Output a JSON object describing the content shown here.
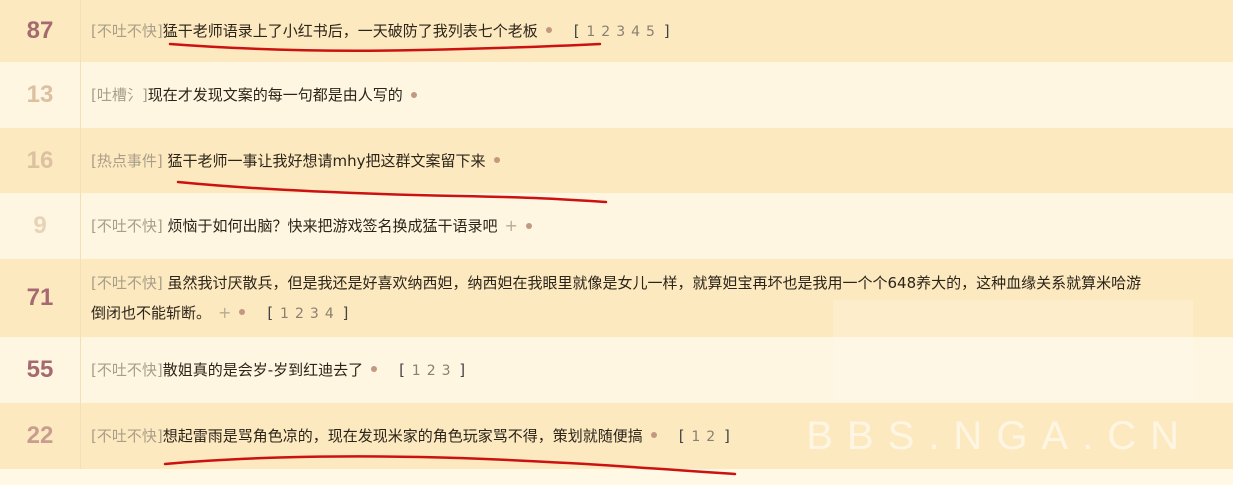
{
  "watermark": "BBS.NGA.CN",
  "colors": {
    "count_high": "#a0666c",
    "count_low": "#e1c7a8",
    "annotation": "#cc1111"
  },
  "rows": [
    {
      "count": "87",
      "category": "[不吐不快]",
      "title": "猛干老师语录上了小红书后，一天破防了我列表七个老板",
      "title_line2": "",
      "plus": false,
      "pages": [
        "1",
        "2",
        "3",
        "4",
        "5"
      ]
    },
    {
      "count": "13",
      "category": "[吐槽氵]",
      "title": "现在才发现文案的每一句都是由人写的",
      "title_line2": "",
      "plus": false,
      "pages": []
    },
    {
      "count": "16",
      "category": "[热点事件]",
      "title": " 猛干老师一事让我好想请mhy把这群文案留下来",
      "title_line2": "",
      "plus": false,
      "pages": []
    },
    {
      "count": "9",
      "category": "[不吐不快]",
      "title": " 烦恼于如何出脑？快来把游戏签名换成猛干语录吧",
      "title_line2": "",
      "plus": true,
      "pages": []
    },
    {
      "count": "71",
      "category": "[不吐不快]",
      "title": " 虽然我讨厌散兵，但是我还是好喜欢纳西妲，纳西妲在我眼里就像是女儿一样，就算妲宝再坏也是我用一个个648养大的，这种血缘关系就算米哈游",
      "title_line2": "倒闭也不能斩断。",
      "plus": true,
      "pages": [
        "1",
        "2",
        "3",
        "4"
      ]
    },
    {
      "count": "55",
      "category": "[不吐不快]",
      "title": "散姐真的是会岁-岁到红迪去了",
      "title_line2": "",
      "plus": false,
      "pages": [
        "1",
        "2",
        "3"
      ]
    },
    {
      "count": "22",
      "category": "[不吐不快]",
      "title": "想起雷雨是骂角色凉的，现在发现米家的角色玩家骂不得，策划就随便搞",
      "title_line2": "",
      "plus": false,
      "pages": [
        "1",
        "2"
      ]
    }
  ]
}
